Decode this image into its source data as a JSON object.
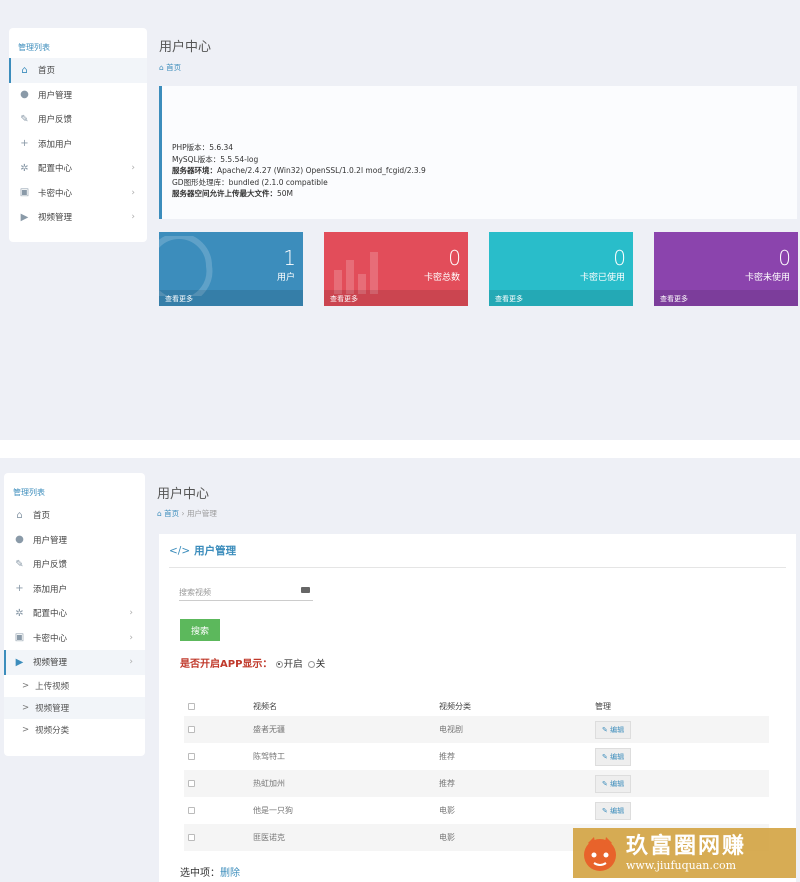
{
  "panel1": {
    "sidebar": {
      "title": "管理列表",
      "items": [
        {
          "label": "首页",
          "icon": "home-icon",
          "glyph": "⌂",
          "chevron": ""
        },
        {
          "label": "用户管理",
          "icon": "user-icon",
          "glyph": "●",
          "chevron": ""
        },
        {
          "label": "用户反馈",
          "icon": "edit-icon",
          "glyph": "✎",
          "chevron": ""
        },
        {
          "label": "添加用户",
          "icon": "add-user-icon",
          "glyph": "+",
          "chevron": ""
        },
        {
          "label": "配置中心",
          "icon": "gear-icon",
          "glyph": "✲",
          "chevron": "›"
        },
        {
          "label": "卡密中心",
          "icon": "card-icon",
          "glyph": "▣",
          "chevron": "›"
        },
        {
          "label": "视频管理",
          "icon": "play-icon",
          "glyph": "▶",
          "chevron": "›"
        }
      ]
    },
    "page_title": "用户中心",
    "breadcrumb": {
      "home": "首页"
    },
    "server_info": [
      {
        "key": "PHP版本：",
        "value": "5.6.34",
        "bold": false
      },
      {
        "key": "MySQL版本：",
        "value": "5.5.54-log",
        "bold": false
      },
      {
        "key": "服务器环境：",
        "value": "Apache/2.4.27 (Win32) OpenSSL/1.0.2l mod_fcgid/2.3.9",
        "bold": true
      },
      {
        "key": "GD图形处理库：",
        "value": "bundled (2.1.0 compatible",
        "bold": false
      },
      {
        "key": "服务器空间允许上传最大文件：",
        "value": "50M",
        "bold": true
      }
    ],
    "tiles": [
      {
        "value": "1",
        "label": "用户",
        "more": "查看更多",
        "color": "#3c8dbc"
      },
      {
        "value": "0",
        "label": "卡密总数",
        "more": "查看更多",
        "color": "#e24d5a"
      },
      {
        "value": "0",
        "label": "卡密已使用",
        "more": "查看更多",
        "color": "#29bdca"
      },
      {
        "value": "0",
        "label": "卡密未使用",
        "more": "查看更多",
        "color": "#8b44ad"
      }
    ]
  },
  "panel2": {
    "sidebar": {
      "title": "管理列表",
      "items": [
        {
          "label": "首页",
          "icon": "home-icon",
          "glyph": "⌂",
          "chevron": ""
        },
        {
          "label": "用户管理",
          "icon": "user-icon",
          "glyph": "●",
          "chevron": ""
        },
        {
          "label": "用户反馈",
          "icon": "edit-icon",
          "glyph": "✎",
          "chevron": ""
        },
        {
          "label": "添加用户",
          "icon": "add-user-icon",
          "glyph": "+",
          "chevron": ""
        },
        {
          "label": "配置中心",
          "icon": "gear-icon",
          "glyph": "✲",
          "chevron": "›"
        },
        {
          "label": "卡密中心",
          "icon": "card-icon",
          "glyph": "▣",
          "chevron": "›"
        },
        {
          "label": "视频管理",
          "icon": "play-icon",
          "glyph": "▶",
          "chevron": "›"
        }
      ],
      "subitems": [
        {
          "label": "上传视频",
          "gt": ">"
        },
        {
          "label": "视频管理",
          "gt": ">"
        },
        {
          "label": "视频分类",
          "gt": ">"
        }
      ]
    },
    "page_title": "用户中心",
    "breadcrumb": {
      "home": "首页",
      "sep": "›",
      "current": "用户管理"
    },
    "card": {
      "code_glyph": "</>",
      "title": "用户管理",
      "search_placeholder": "搜索视频",
      "search_button": "搜索",
      "app_toggle": {
        "question": "是否开启APP显示：",
        "on": "开启",
        "off": "关"
      },
      "table": {
        "headers": [
          "",
          "视频名",
          "视频分类",
          "管理"
        ],
        "rows": [
          {
            "name": "盛者无疆",
            "category": "电视剧",
            "action": "编辑"
          },
          {
            "name": "陈驾特工",
            "category": "推荐",
            "action": "编辑"
          },
          {
            "name": "热虹加州",
            "category": "推荐",
            "action": "编辑"
          },
          {
            "name": "他是一只狗",
            "category": "电影",
            "action": "编辑"
          },
          {
            "name": "匪医诺克",
            "category": "电影",
            "action": ""
          }
        ]
      },
      "selected_label": "选中项：",
      "delete_link": "删除",
      "edit_glyph": "✎"
    }
  },
  "watermark": {
    "text": "玖富圈网赚",
    "url": "www.jiufuquan.com"
  }
}
